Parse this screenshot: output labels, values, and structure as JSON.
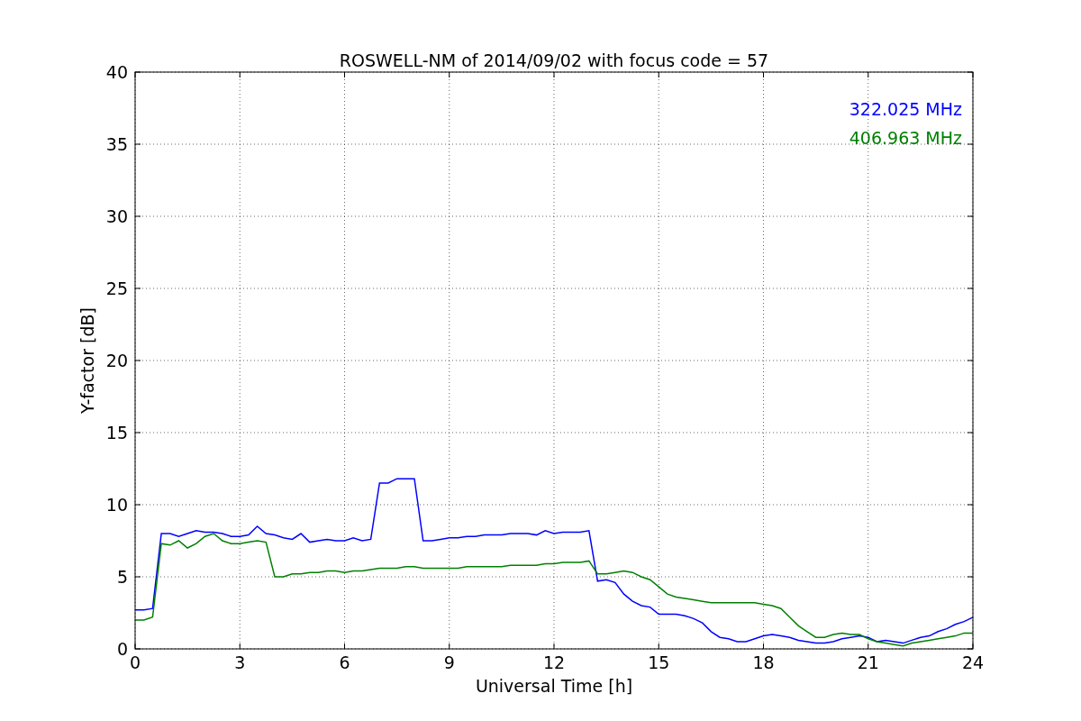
{
  "chart_data": {
    "type": "line",
    "title": "ROSWELL-NM of 2014/09/02 with focus code = 57",
    "xlabel": "Universal Time [h]",
    "ylabel": "Y-factor [dB]",
    "x": [
      0,
      0.25,
      0.5,
      0.75,
      1,
      1.25,
      1.5,
      1.75,
      2,
      2.25,
      2.5,
      2.75,
      3,
      3.25,
      3.5,
      3.75,
      4,
      4.25,
      4.5,
      4.75,
      5,
      5.25,
      5.5,
      5.75,
      6,
      6.25,
      6.5,
      6.75,
      7,
      7.25,
      7.5,
      7.75,
      8,
      8.25,
      8.5,
      8.75,
      9,
      9.25,
      9.5,
      9.75,
      10,
      10.25,
      10.5,
      10.75,
      11,
      11.25,
      11.5,
      11.75,
      12,
      12.25,
      12.5,
      12.75,
      13,
      13.25,
      13.5,
      13.75,
      14,
      14.25,
      14.5,
      14.75,
      15,
      15.25,
      15.5,
      15.75,
      16,
      16.25,
      16.5,
      16.75,
      17,
      17.25,
      17.5,
      17.75,
      18,
      18.25,
      18.5,
      18.75,
      19,
      19.25,
      19.5,
      19.75,
      20,
      20.25,
      20.5,
      20.75,
      21,
      21.25,
      21.5,
      21.75,
      22,
      22.25,
      22.5,
      22.75,
      23,
      23.25,
      23.5,
      23.75,
      24
    ],
    "series": [
      {
        "name": "322.025 MHz",
        "color": "#0000ff",
        "values": [
          2.7,
          2.7,
          2.8,
          8,
          8,
          7.8,
          8,
          8.2,
          8.1,
          8.1,
          8,
          7.8,
          7.8,
          7.9,
          8.5,
          8,
          7.9,
          7.7,
          7.6,
          8,
          7.4,
          7.5,
          7.6,
          7.5,
          7.5,
          7.7,
          7.5,
          7.6,
          11.5,
          11.5,
          11.8,
          11.8,
          11.8,
          7.5,
          7.5,
          7.6,
          7.7,
          7.7,
          7.8,
          7.8,
          7.9,
          7.9,
          7.9,
          8,
          8,
          8,
          7.9,
          8.2,
          8,
          8.1,
          8.1,
          8.1,
          8.2,
          4.7,
          4.8,
          4.6,
          3.8,
          3.3,
          3,
          2.9,
          2.4,
          2.4,
          2.4,
          2.3,
          2.1,
          1.8,
          1.2,
          0.8,
          0.7,
          0.5,
          0.5,
          0.7,
          0.9,
          1,
          0.9,
          0.8,
          0.6,
          0.5,
          0.4,
          0.4,
          0.5,
          0.7,
          0.8,
          0.9,
          0.8,
          0.5,
          0.6,
          0.5,
          0.4,
          0.6,
          0.8,
          0.9,
          1.2,
          1.4,
          1.7,
          1.9,
          2.2
        ]
      },
      {
        "name": "406.963 MHz",
        "color": "#008000",
        "values": [
          2,
          2,
          2.2,
          7.3,
          7.2,
          7.5,
          7,
          7.3,
          7.8,
          8,
          7.5,
          7.3,
          7.3,
          7.4,
          7.5,
          7.4,
          5,
          5,
          5.2,
          5.2,
          5.3,
          5.3,
          5.4,
          5.4,
          5.3,
          5.4,
          5.4,
          5.5,
          5.6,
          5.6,
          5.6,
          5.7,
          5.7,
          5.6,
          5.6,
          5.6,
          5.6,
          5.6,
          5.7,
          5.7,
          5.7,
          5.7,
          5.7,
          5.8,
          5.8,
          5.8,
          5.8,
          5.9,
          5.9,
          6,
          6,
          6,
          6.1,
          5.2,
          5.2,
          5.3,
          5.4,
          5.3,
          5,
          4.8,
          4.3,
          3.8,
          3.6,
          3.5,
          3.4,
          3.3,
          3.2,
          3.2,
          3.2,
          3.2,
          3.2,
          3.2,
          3.1,
          3,
          2.8,
          2.2,
          1.6,
          1.2,
          0.8,
          0.8,
          1,
          1.1,
          1,
          1,
          0.7,
          0.5,
          0.4,
          0.3,
          0.2,
          0.4,
          0.5,
          0.6,
          0.7,
          0.8,
          0.9,
          1.1,
          1.1
        ]
      }
    ],
    "xlim": [
      0,
      24
    ],
    "ylim": [
      0,
      40
    ],
    "xticks": [
      0,
      3,
      6,
      9,
      12,
      15,
      18,
      21,
      24
    ],
    "yticks": [
      0,
      5,
      10,
      15,
      20,
      25,
      30,
      35,
      40
    ],
    "grid": true
  }
}
